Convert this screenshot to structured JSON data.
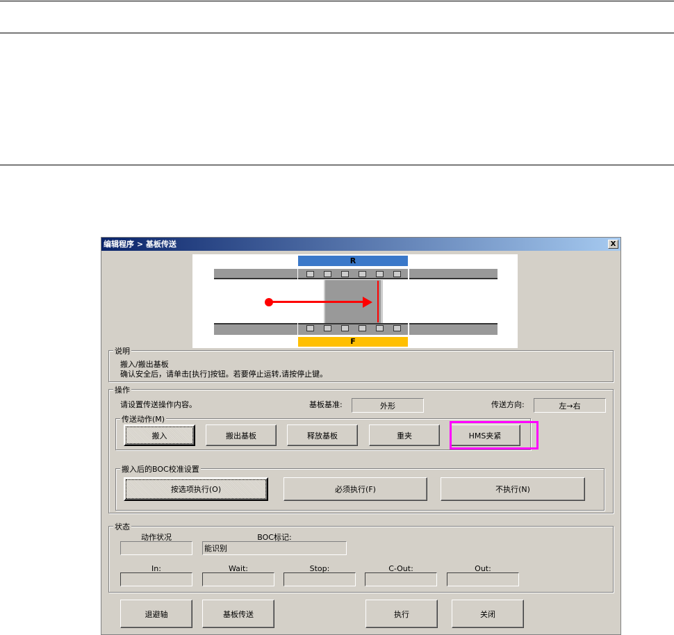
{
  "window": {
    "title": "编辑程序 > 基板传送",
    "close": "X"
  },
  "diagram": {
    "rear_label": "R",
    "front_label": "F",
    "rear_color": "#3a78c9",
    "front_color": "#ffbf00",
    "arrow_color": "#ff0000"
  },
  "description": {
    "group_label": "说明",
    "line1": "搬入/搬出基板",
    "line2": "确认安全后，请单击[执行]按钮。若要停止运转,请按停止键。"
  },
  "operation": {
    "group_label": "操作",
    "prompt": "请设置传送操作内容。",
    "board_ref_label": "基板基准:",
    "board_ref_value": "外形",
    "direction_label": "传送方向:",
    "direction_value": "左→右",
    "transfer_group_label": "传送动作(M)",
    "transfer_buttons": [
      "搬入",
      "搬出基板",
      "释放基板",
      "重夹",
      "HMS夹紧"
    ],
    "boc_group_label": "搬入后的BOC校准设置",
    "boc_buttons": [
      "按选项执行(O)",
      "必须执行(F)",
      "不执行(N)"
    ]
  },
  "status": {
    "group_label": "状态",
    "action_label": "动作状况",
    "action_value": "",
    "boc_label": "BOC标记:",
    "boc_value": "能识别",
    "sensors": [
      {
        "label": "In:",
        "value": ""
      },
      {
        "label": "Wait:",
        "value": ""
      },
      {
        "label": "Stop:",
        "value": ""
      },
      {
        "label": "C-Out:",
        "value": ""
      },
      {
        "label": "Out:",
        "value": ""
      }
    ]
  },
  "footer": {
    "buttons": [
      "退避轴",
      "基板传送",
      "执行",
      "关闭"
    ]
  }
}
